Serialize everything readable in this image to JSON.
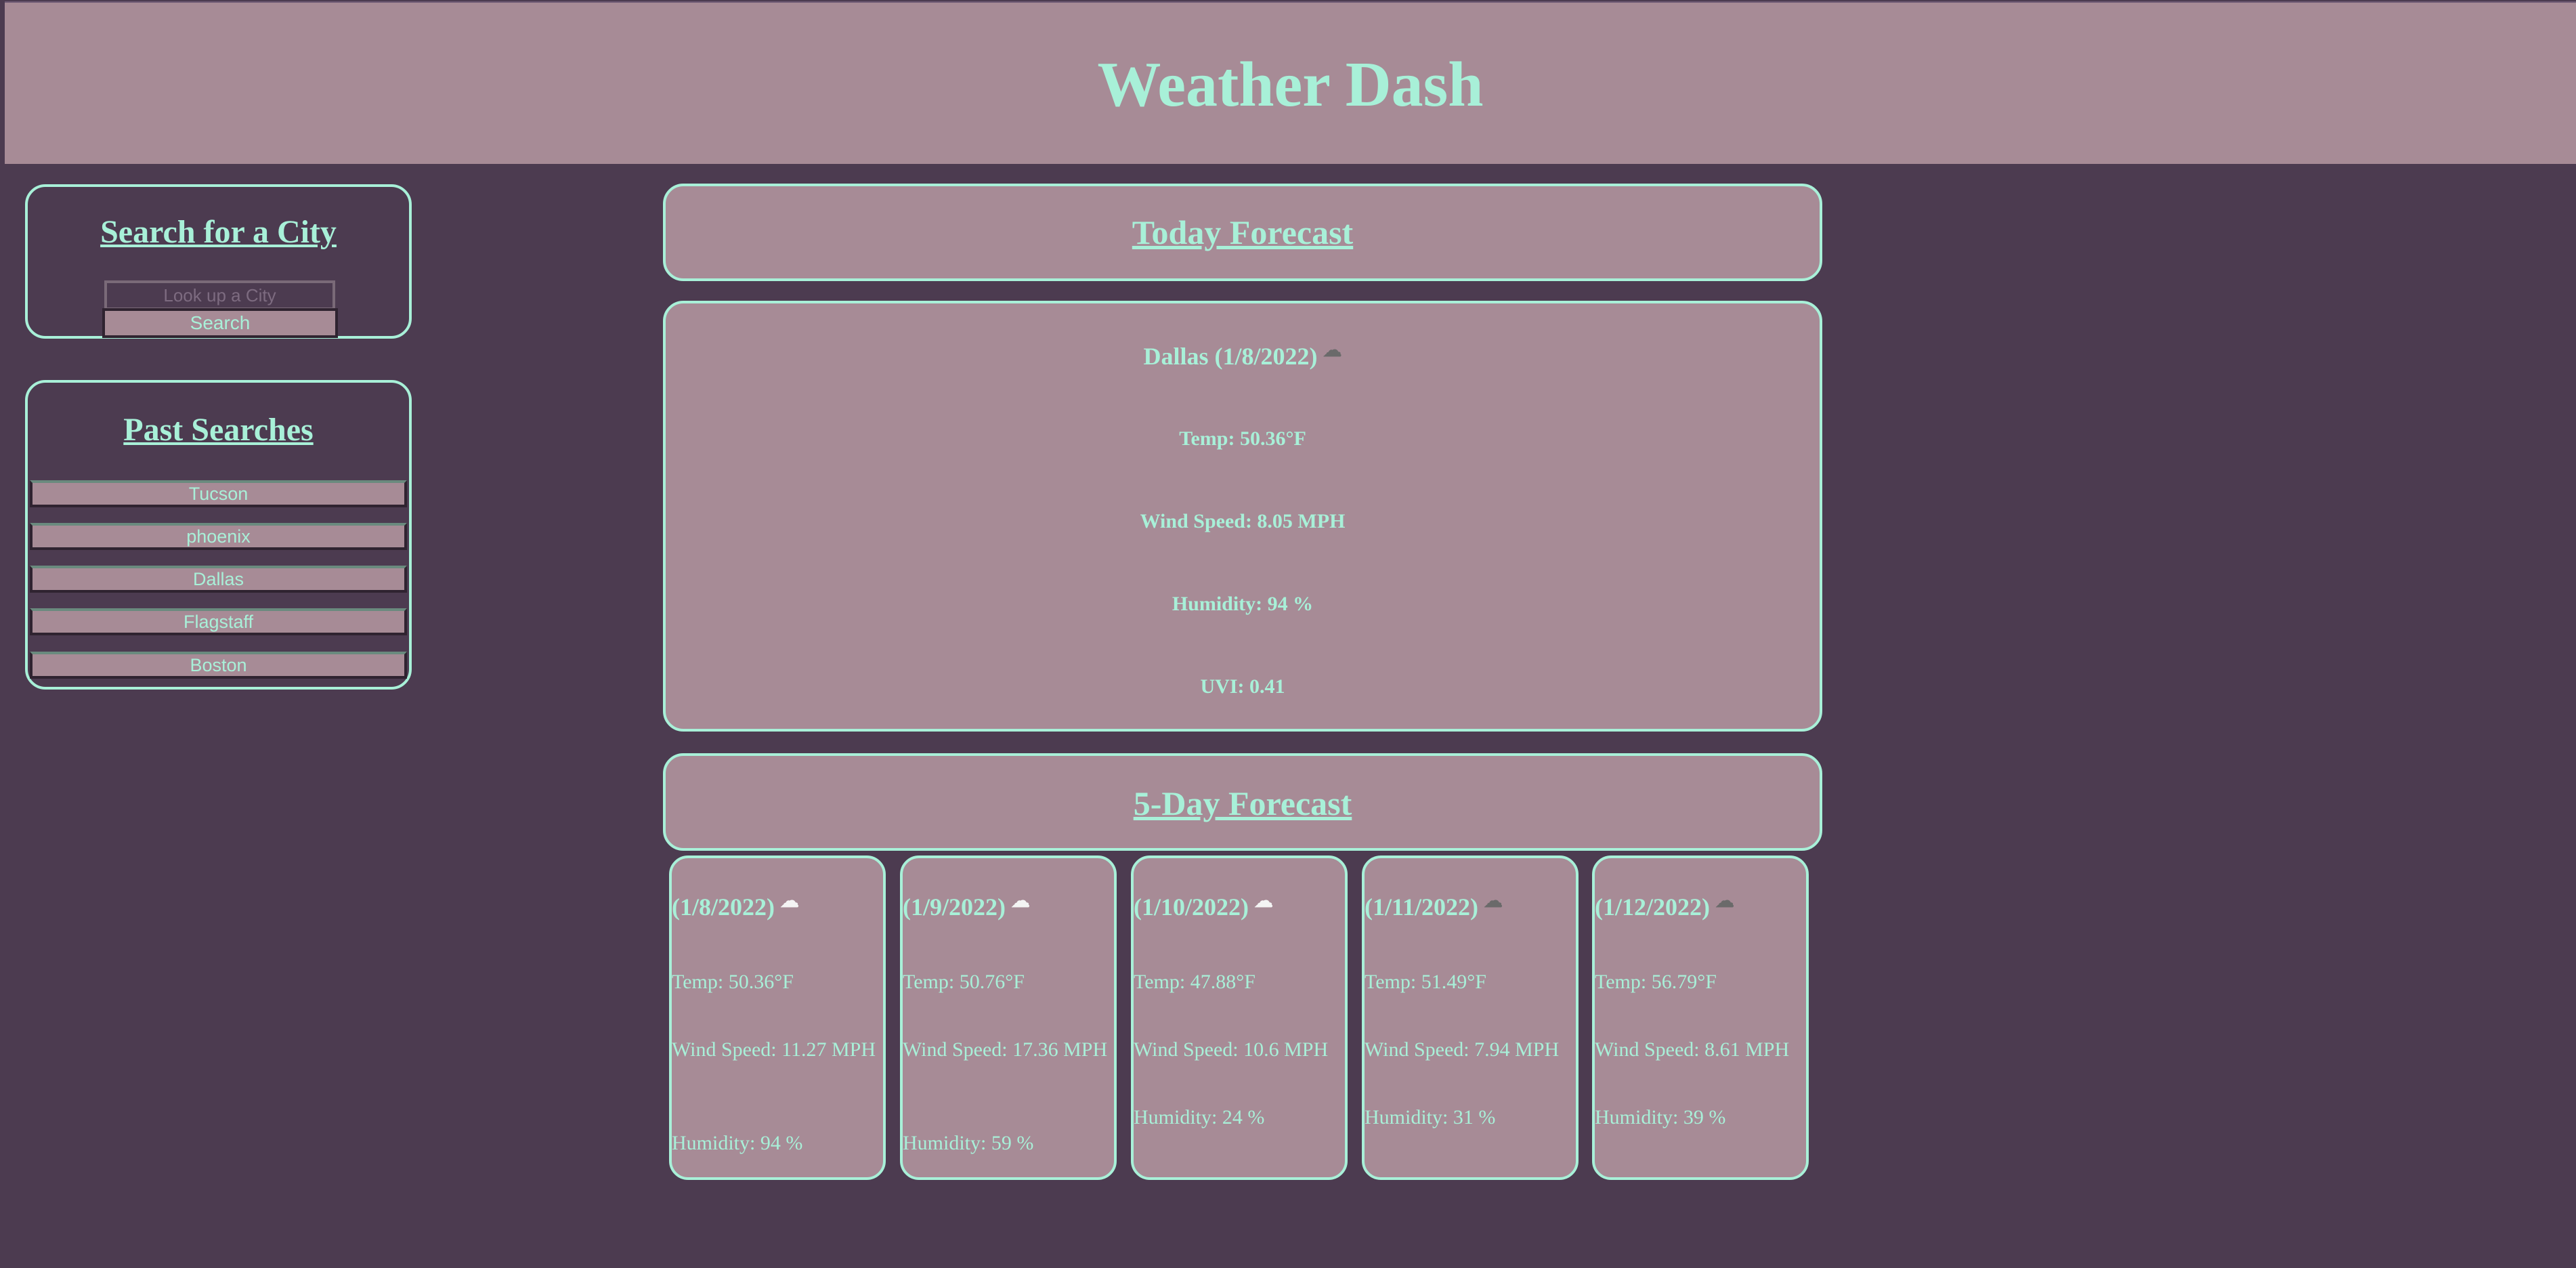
{
  "header": {
    "title": "Weather Dash"
  },
  "search": {
    "heading": "Search for a City",
    "placeholder": "Look up a City",
    "button_label": "Search"
  },
  "history": {
    "heading": "Past Searches",
    "items": [
      "Tucson",
      "phoenix",
      "Dallas",
      "Flagstaff",
      "Boston"
    ]
  },
  "today": {
    "heading": "Today Forecast",
    "title": "Dallas (1/8/2022)",
    "icon": "cloud-icon",
    "temp": "Temp: 50.36°F",
    "wind": "Wind Speed: 8.05 MPH",
    "humidity": "Humidity: 94 %",
    "uvi": "UVI: 0.41"
  },
  "forecast": {
    "heading": "5-Day Forecast",
    "days": [
      {
        "date": "(1/8/2022)",
        "icon": "cloud-icon",
        "temp": "Temp: 50.36°F",
        "wind": "Wind Speed: 11.27 MPH",
        "humidity": "Humidity: 94 %"
      },
      {
        "date": "(1/9/2022)",
        "icon": "cloud-icon",
        "temp": "Temp: 50.76°F",
        "wind": "Wind Speed: 17.36 MPH",
        "humidity": "Humidity: 59 %"
      },
      {
        "date": "(1/10/2022)",
        "icon": "cloud-icon",
        "temp": "Temp: 47.88°F",
        "wind": "Wind Speed: 10.6 MPH",
        "humidity": "Humidity: 24 %"
      },
      {
        "date": "(1/11/2022)",
        "icon": "cloud-icon",
        "temp": "Temp: 51.49°F",
        "wind": "Wind Speed: 7.94 MPH",
        "humidity": "Humidity: 31 %"
      },
      {
        "date": "(1/12/2022)",
        "icon": "cloud-icon",
        "temp": "Temp: 56.79°F",
        "wind": "Wind Speed: 8.61 MPH",
        "humidity": "Humidity: 39 %"
      }
    ]
  },
  "colors": {
    "background": "#4c3b50",
    "panel": "#a78b96",
    "accent": "#a8f0d8"
  }
}
